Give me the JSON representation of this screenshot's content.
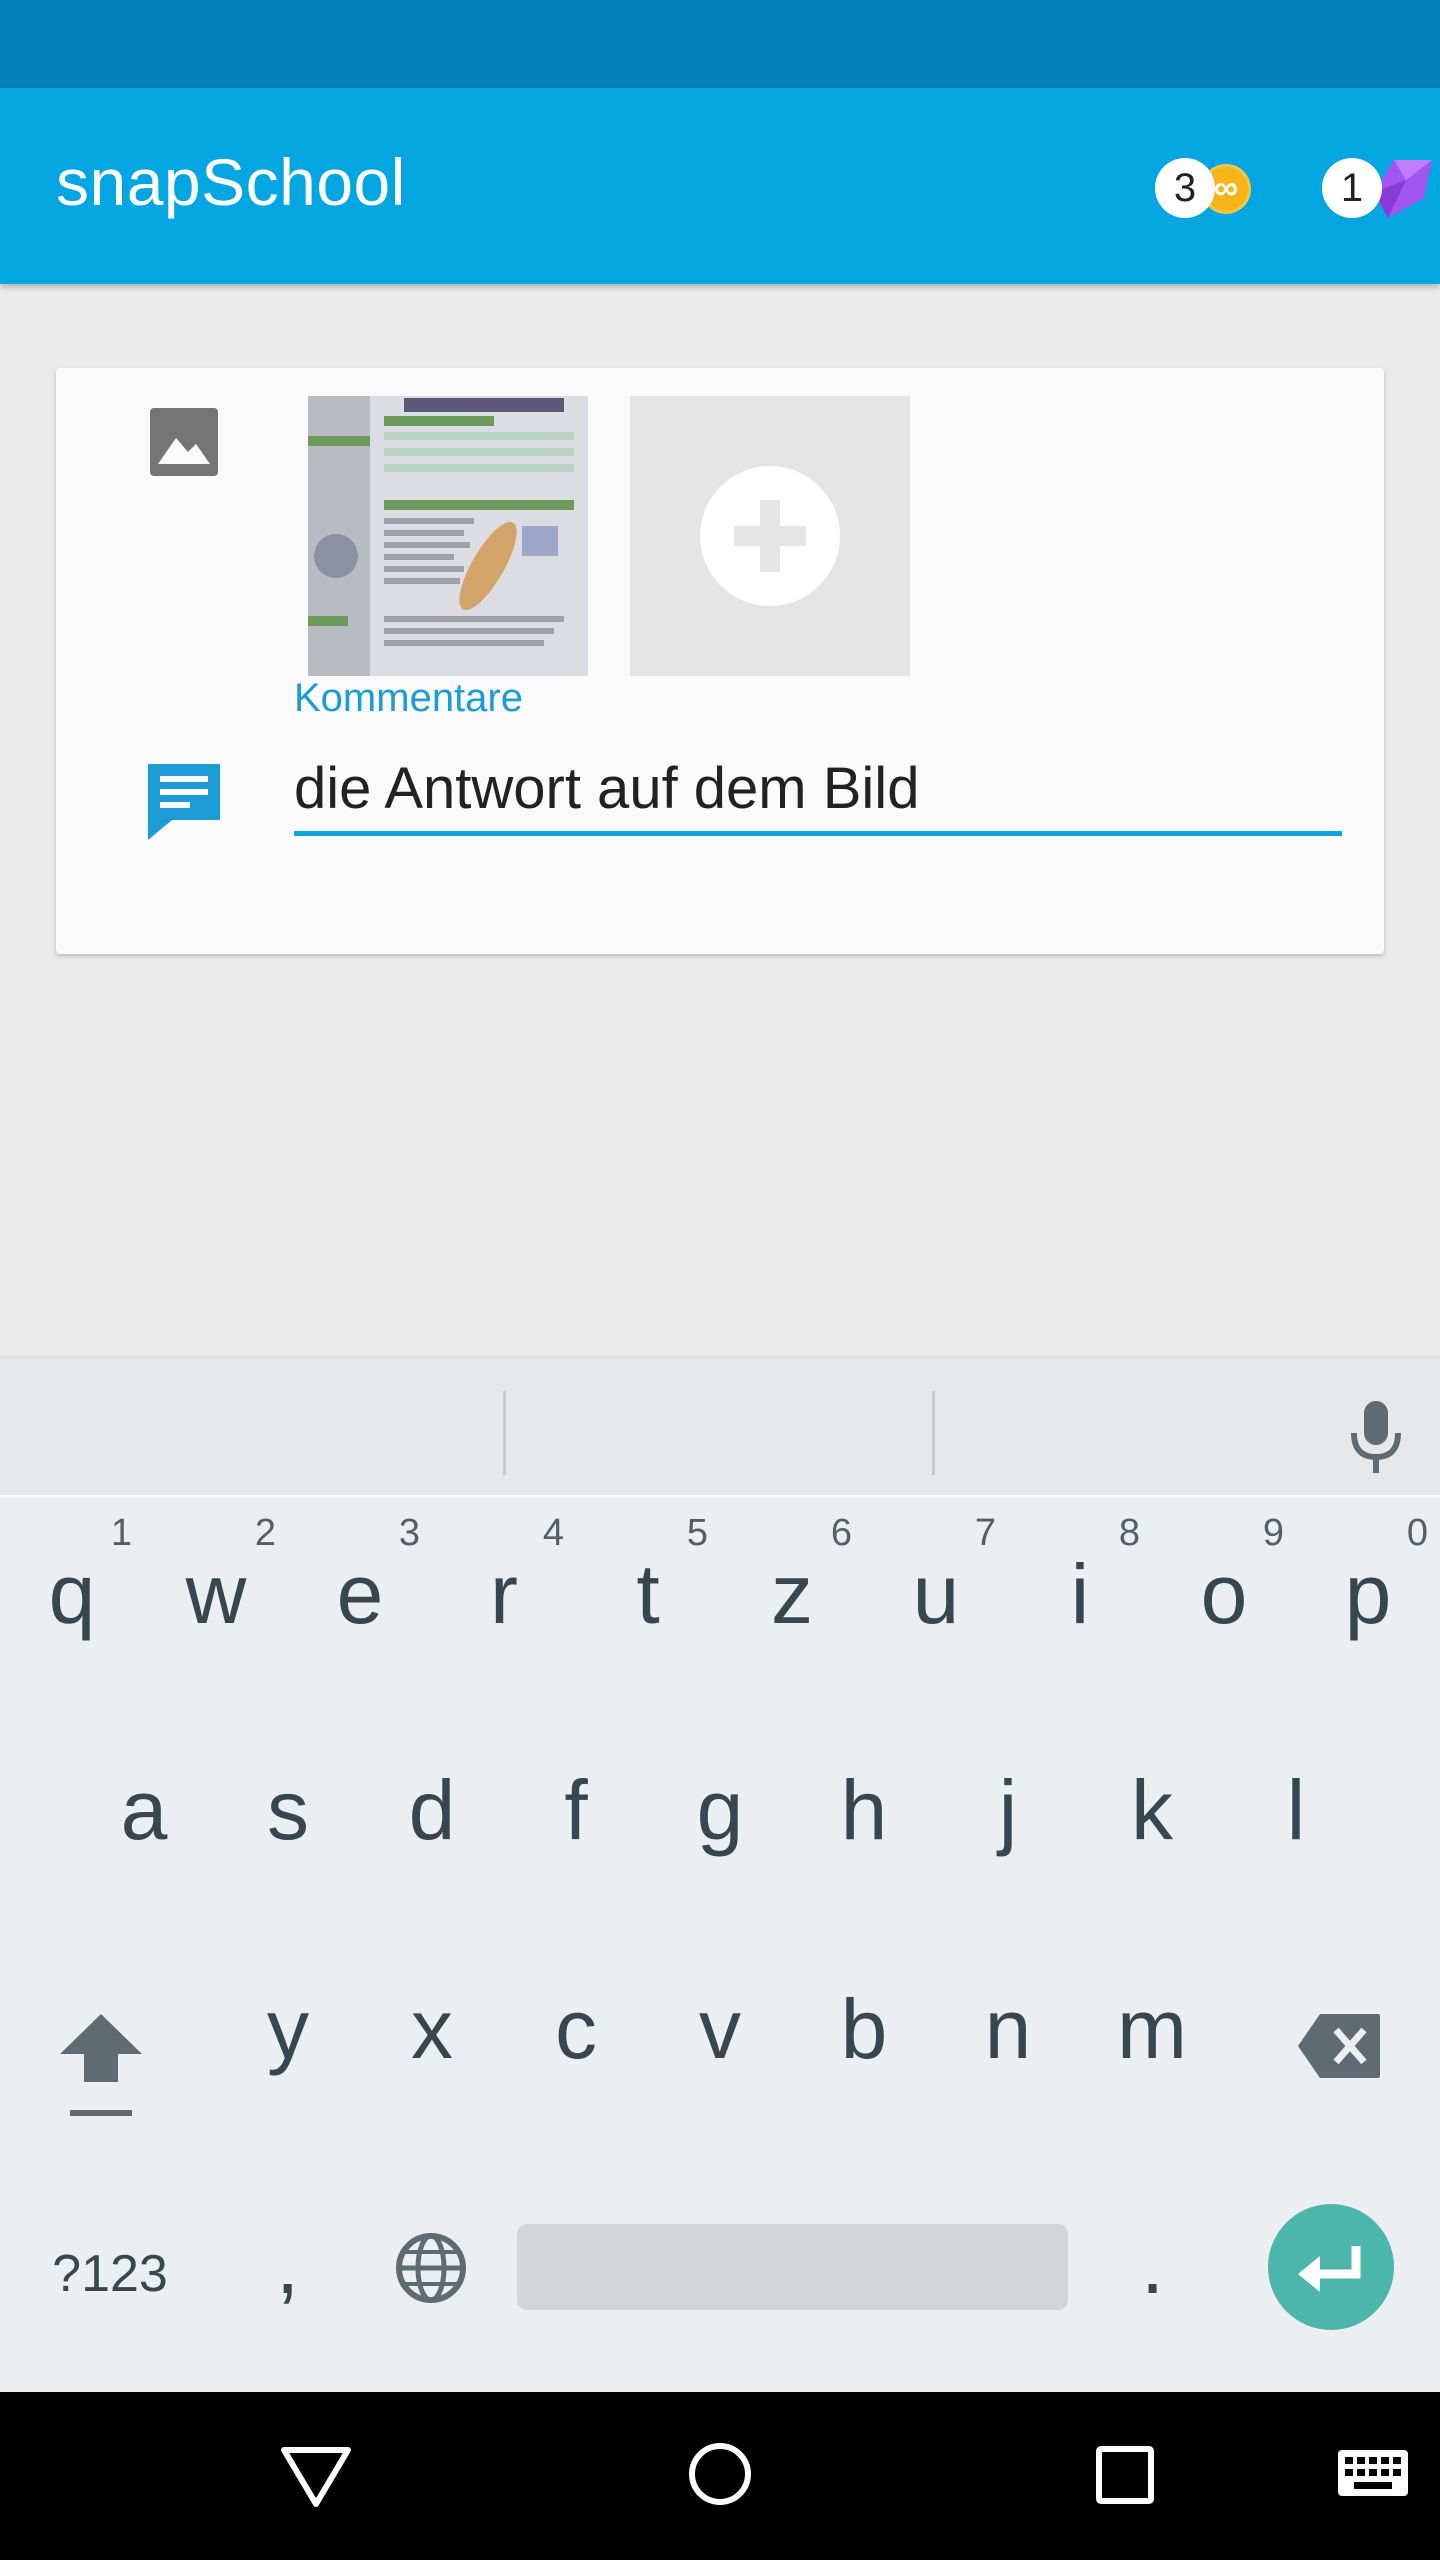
{
  "app": {
    "title": "snapSchool"
  },
  "header": {
    "points_count": "3",
    "points_symbol": "∞",
    "gems_count": "1",
    "brand_color": "#03a6e0",
    "status_bar_color": "#0582b8",
    "coin_color": "#f7b418",
    "gem_color": "#a455f0"
  },
  "card": {
    "images": [
      {
        "icon": "textbook-photo-thumbnail"
      }
    ],
    "add_image_icon": "plus-icon",
    "comment_label": "Kommentare",
    "comment_value": "die Antwort auf dem Bild",
    "accent_color": "#10a2dc"
  },
  "keyboard": {
    "row1": [
      {
        "key": "q",
        "hint": "1"
      },
      {
        "key": "w",
        "hint": "2"
      },
      {
        "key": "e",
        "hint": "3"
      },
      {
        "key": "r",
        "hint": "4"
      },
      {
        "key": "t",
        "hint": "5"
      },
      {
        "key": "z",
        "hint": "6"
      },
      {
        "key": "u",
        "hint": "7"
      },
      {
        "key": "i",
        "hint": "8"
      },
      {
        "key": "o",
        "hint": "9"
      },
      {
        "key": "p",
        "hint": "0"
      }
    ],
    "row2": [
      "a",
      "s",
      "d",
      "f",
      "g",
      "h",
      "j",
      "k",
      "l"
    ],
    "row3": [
      "y",
      "x",
      "c",
      "v",
      "b",
      "n",
      "m"
    ],
    "symbols_label": "?123",
    "comma": ",",
    "period": ".",
    "enter_color": "#4db6ac"
  },
  "nav": {
    "icons": [
      "back-icon",
      "home-icon",
      "recents-icon",
      "keyboard-switch-icon"
    ]
  }
}
